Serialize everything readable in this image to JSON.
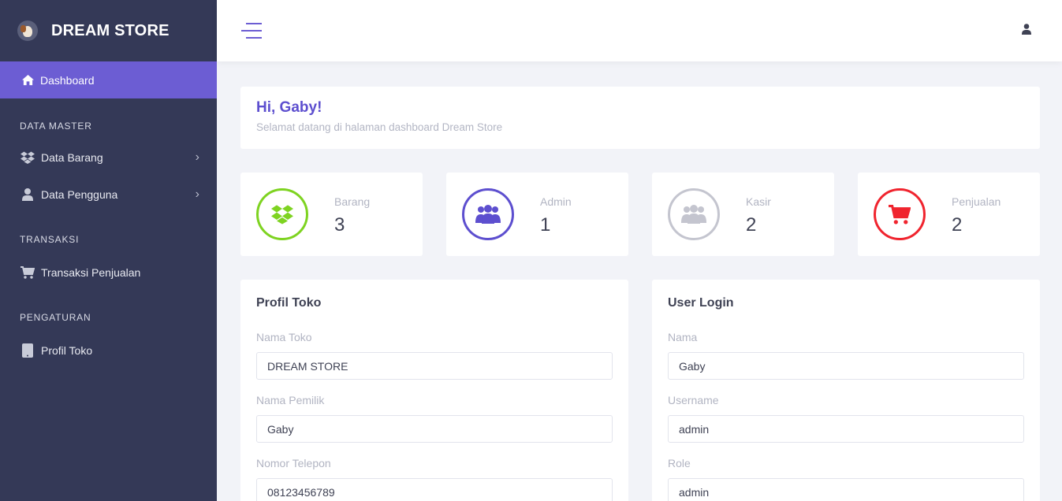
{
  "app": {
    "title": "DREAM STORE"
  },
  "sidebar": {
    "active": {
      "label": "Dashboard"
    },
    "sections": [
      {
        "title": "DATA MASTER",
        "items": [
          {
            "label": "Data Barang",
            "icon": "dropbox-icon"
          },
          {
            "label": "Data Pengguna",
            "icon": "user-icon"
          }
        ]
      },
      {
        "title": "TRANSAKSI",
        "items": [
          {
            "label": "Transaksi Penjualan",
            "icon": "cart-icon"
          }
        ]
      },
      {
        "title": "PENGATURAN",
        "items": [
          {
            "label": "Profil Toko",
            "icon": "tablet-icon"
          }
        ]
      }
    ]
  },
  "welcome": {
    "greeting": "Hi, Gaby!",
    "subtitle": "Selamat datang di halaman dashboard Dream Store"
  },
  "stats": [
    {
      "label": "Barang",
      "value": "3",
      "color": "#7ed321",
      "icon": "dropbox-icon"
    },
    {
      "label": "Admin",
      "value": "1",
      "color": "#5d4fcf",
      "icon": "users-icon"
    },
    {
      "label": "Kasir",
      "value": "2",
      "color": "#c4c5cf",
      "icon": "users-icon"
    },
    {
      "label": "Penjualan",
      "value": "2",
      "color": "#f0242e",
      "icon": "cart-icon"
    }
  ],
  "profil": {
    "title": "Profil Toko",
    "fields": [
      {
        "label": "Nama Toko",
        "value": "DREAM STORE"
      },
      {
        "label": "Nama Pemilik",
        "value": "Gaby"
      },
      {
        "label": "Nomor Telepon",
        "value": "08123456789"
      }
    ]
  },
  "user_login": {
    "title": "User Login",
    "fields": [
      {
        "label": "Nama",
        "value": "Gaby"
      },
      {
        "label": "Username",
        "value": "admin"
      },
      {
        "label": "Role",
        "value": "admin"
      }
    ]
  },
  "colors": {
    "accent": "#6c5dd3",
    "sidebar": "#343957"
  }
}
